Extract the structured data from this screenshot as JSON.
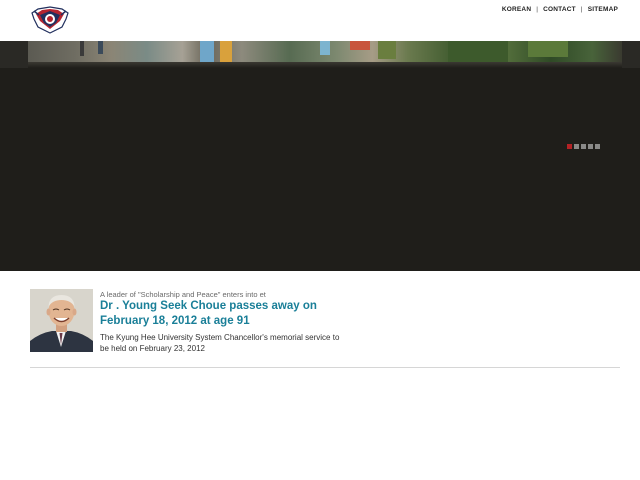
{
  "header": {
    "logo_icon": "university-crest-icon",
    "nav": [
      {
        "label": "KOREAN"
      },
      {
        "label": "CONTACT"
      },
      {
        "label": "SITEMAP"
      }
    ]
  },
  "hero": {
    "slides_total": 5,
    "active_slide": 1,
    "accent_color": "#b42225"
  },
  "news": {
    "eyebrow": "A leader of \"Scholarship and Peace\" enters into et",
    "title": "Dr . Young Seek Choue passes away on February 18, 2012 at age 91",
    "description": "The Kyung Hee University System Chancellor's memorial service to be held on February 23, 2012",
    "title_color": "#1a7f98"
  }
}
